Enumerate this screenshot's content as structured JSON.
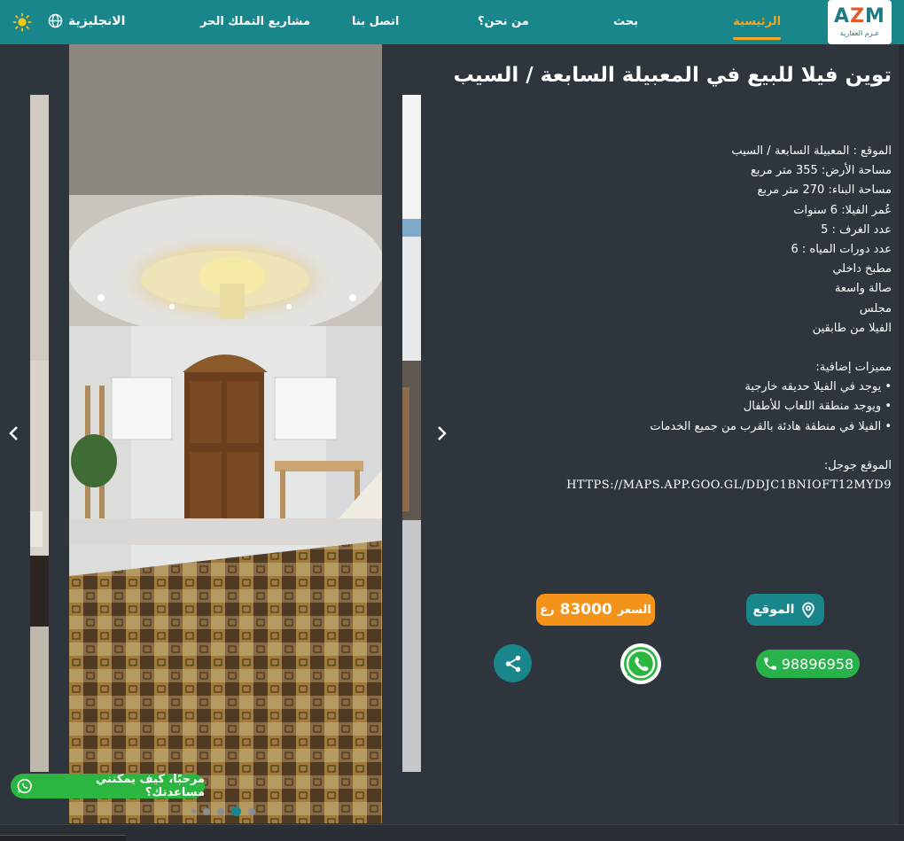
{
  "nav": {
    "logo_text": "AZM",
    "logo_sub": "عـزم العقارية",
    "links": [
      {
        "label": "الرئيسية"
      },
      {
        "label": "بحث"
      },
      {
        "label": "من نحن؟"
      },
      {
        "label": "اتصل بنا"
      },
      {
        "label": "مشاريع التملك الحر"
      }
    ],
    "language": "الانجليزية"
  },
  "gallery": {
    "dots_count": 5,
    "active_dot": 3
  },
  "listing": {
    "title": "توين فيلا للبيع في المعبيلة السابعة / السيب",
    "details": [
      "الموقع : المعبيلة السابعة / السيب",
      "مساحة الأرض: 355 متر مربع",
      "مساحة البناء: 270 متر مربع",
      "عُمر الفيلا:  6 سنوات",
      "عدد الغرف :  5",
      "عدد دورات المياه : 6",
      "مطبخ داخلي",
      "صالة واسعة",
      "مجلس",
      "الفيلا من طابقين",
      "",
      "مميزات إضافية:",
      "• يوجد في الفيلا حديقه خارجية",
      "• ويوجد منطقة اللعاب للأطفال",
      "• الفيلا في منطقة هادئة بالقرب من جميع الخدمات",
      "",
      "الموقع جوجل:"
    ],
    "map_url": "HTTPS://MAPS.APP.GOO.GL/DDJC1BNIOFT12MYD9",
    "location_button": "الموقع",
    "price_label": "السعر",
    "price_value": "83000",
    "price_currency": "رع",
    "phone": "98896958"
  },
  "chat": {
    "label": "مرحبًا، كيف يمكنني مساعدتك؟"
  },
  "colors": {
    "primary": "#19868c",
    "accent": "#f5a623",
    "price": "#f39319",
    "whatsapp": "#27b24a",
    "background": "#2f353d"
  }
}
